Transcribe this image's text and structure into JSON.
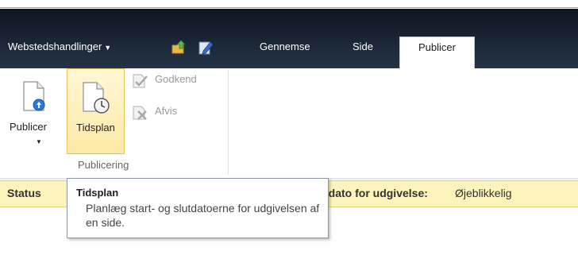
{
  "header": {
    "site_actions_label": "Webstedshandlinger",
    "site_actions_caret_icon": "triangle-down",
    "navigate_up_icon": "folder-up-arrow-icon",
    "edit_icon": "edit-page-icon"
  },
  "tabs": [
    {
      "label": "Gennemse",
      "selected": false
    },
    {
      "label": "Side",
      "selected": false
    },
    {
      "label": "Publicer",
      "selected": true
    }
  ],
  "ribbon": {
    "publish_group": {
      "label": "Publicering",
      "buttons": {
        "publicer": {
          "label": "Publicer",
          "icon": "document-publish-icon",
          "enabled": true,
          "has_dropdown": true
        },
        "tidsplan": {
          "label": "Tidsplan",
          "icon": "document-clock-icon",
          "enabled": true,
          "active": true
        },
        "godkend": {
          "label": "Godkend",
          "icon": "approve-icon",
          "enabled": false
        },
        "afvis": {
          "label": "Afvis",
          "icon": "reject-icon",
          "enabled": false
        }
      }
    }
  },
  "status": {
    "label": "Status",
    "date_label": "tdato for udgivelse:",
    "date_value": "Øjeblikkelig"
  },
  "tooltip": {
    "title": "Tidsplan",
    "body": "Planlæg start- og slutdatoerne for udgivelsen af en side."
  },
  "colors": {
    "title_bar": "#1a2636",
    "status_bar": "#fdf4bb",
    "active_button": "#fde9a6"
  }
}
